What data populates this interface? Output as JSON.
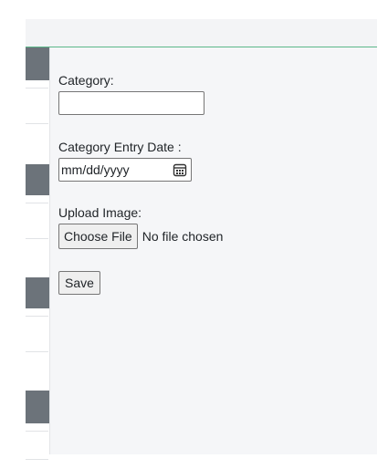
{
  "form": {
    "category_label": "Category:",
    "category_value": "",
    "date_label": "Category Entry Date :",
    "date_placeholder": "mm/dd/yyyy",
    "image_label": "Upload Image:",
    "file_button_label": "Choose File",
    "file_status": "No file chosen",
    "save_label": "Save"
  },
  "icons": {
    "calendar": "calendar-icon"
  },
  "colors": {
    "topbar_accent": "#5cb88a",
    "sidebar_block": "#6c737a",
    "panel_background": "#f5f6f8"
  }
}
